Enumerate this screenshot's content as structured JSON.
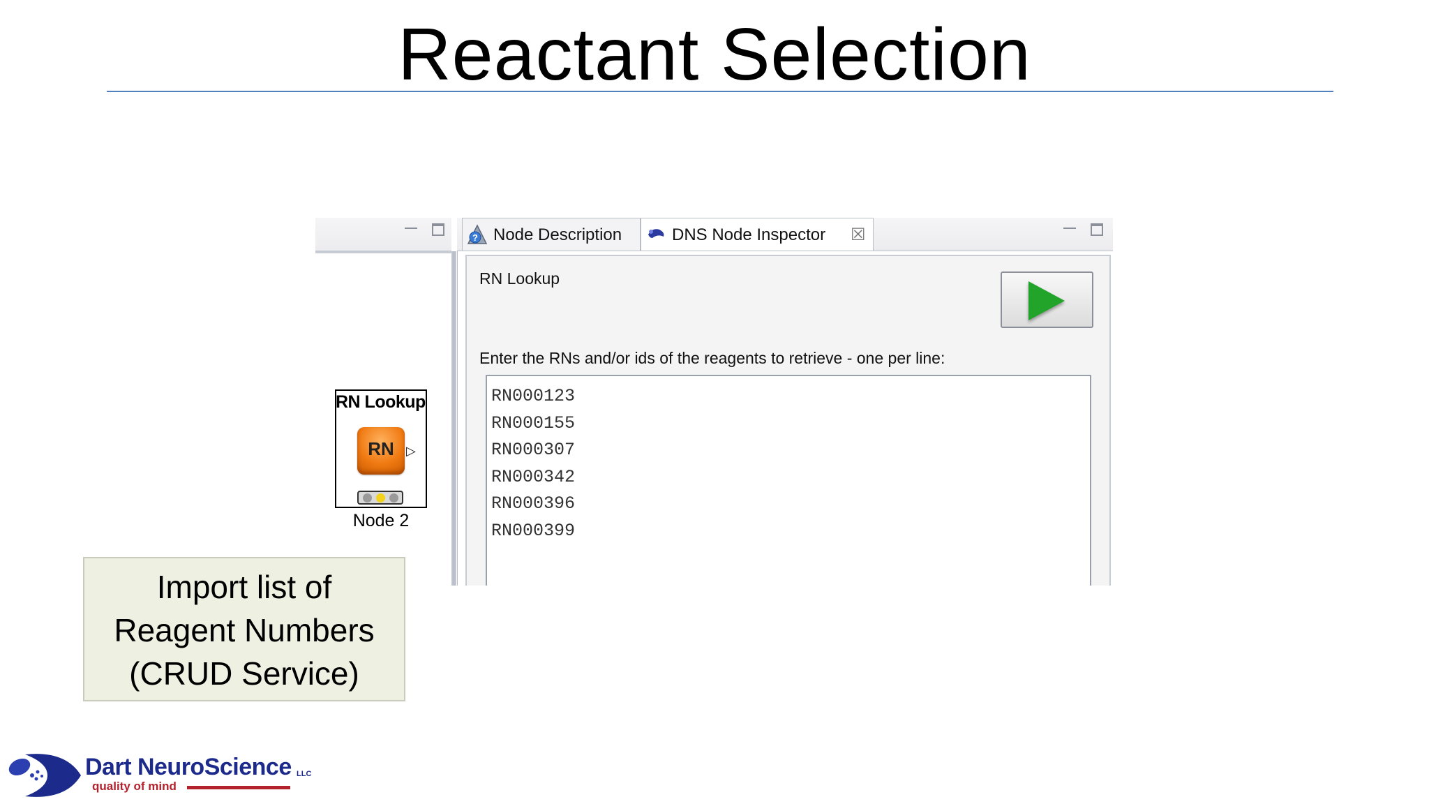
{
  "slide": {
    "title": "Reactant Selection"
  },
  "node": {
    "title": "RN Lookup",
    "icon_text": "RN",
    "label": "Node 2",
    "status_colors": [
      "#9a9a9a",
      "#f2d21b",
      "#9a9a9a"
    ]
  },
  "inspector": {
    "tabs": [
      {
        "label": "Node Description",
        "icon": "help-icon"
      },
      {
        "label": "DNS Node Inspector",
        "icon": "dns-icon"
      }
    ],
    "section_title": "RN Lookup",
    "run_icon": "play-icon",
    "instruction": "Enter the RNs and/or ids of the reagents to retrieve - one per line:",
    "reagent_numbers": [
      "RN000123",
      "RN000155",
      "RN000307",
      "RN000342",
      "RN000396",
      "RN000399"
    ]
  },
  "callout": {
    "lines": [
      "Import list of",
      "Reagent Numbers",
      "(CRUD Service)"
    ]
  },
  "logo": {
    "name": "Dart NeuroScience",
    "suffix": "LLC",
    "tagline": "quality of mind"
  },
  "colors": {
    "title_rule": "#4f81bd",
    "play": "#22a32a",
    "node_orange": "#f07a12",
    "callout_bg": "#eef0e2",
    "logo_blue": "#1c2a8c",
    "logo_red": "#b3212c"
  }
}
